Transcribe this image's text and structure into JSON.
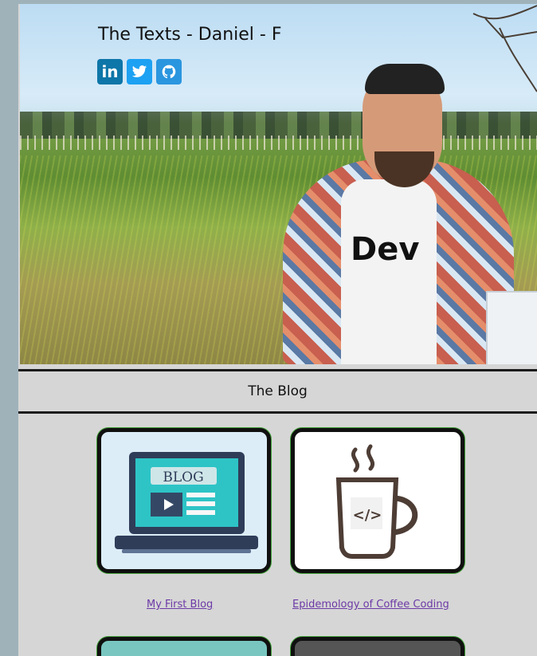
{
  "header": {
    "title": "The Texts - Daniel - F"
  },
  "social": {
    "linkedin": "in",
    "twitter_icon": "twitter-bird",
    "github_icon": "github-octocat"
  },
  "blog_section": {
    "title": "The Blog"
  },
  "posts": [
    {
      "link": "My First Blog",
      "thumbnail_text": "BLOG"
    },
    {
      "link": "Epidemology of Coffee Coding",
      "thumbnail_text": "</>"
    }
  ],
  "hero_art": {
    "shirt_text": "Dev"
  }
}
